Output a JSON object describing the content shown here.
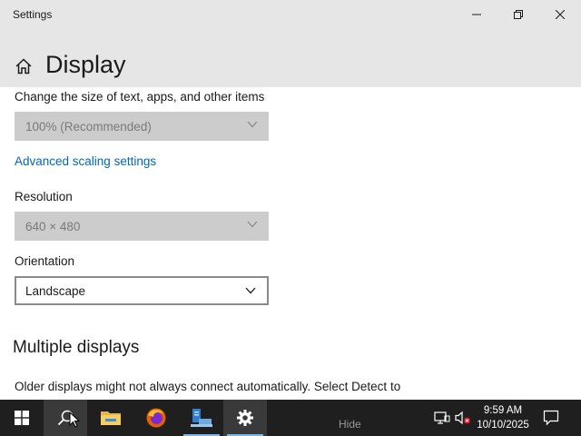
{
  "window": {
    "title": "Settings"
  },
  "header": {
    "title": "Display"
  },
  "scale": {
    "label": "Change the size of text, apps, and other items",
    "value": "100% (Recommended)",
    "advanced_link": "Advanced scaling settings"
  },
  "resolution": {
    "label": "Resolution",
    "value": "640 × 480"
  },
  "orientation": {
    "label": "Orientation",
    "value": "Landscape"
  },
  "multiple_displays": {
    "title": "Multiple displays",
    "description": "Older displays might not always connect automatically. Select Detect to"
  },
  "taskbar": {
    "hide_label": "Hide",
    "apps": [
      "start-icon",
      "search-icon",
      "file-explorer-icon",
      "firefox-icon",
      "server-manager-icon",
      "settings-icon"
    ],
    "clock_time": "9:59 AM",
    "clock_date": "10/10/2025"
  },
  "colors": {
    "accent": "#0067b8",
    "taskbar_bg": "#1f1f1f",
    "header_bg": "#e6e6e6",
    "disabled_field": "#cccccc"
  }
}
